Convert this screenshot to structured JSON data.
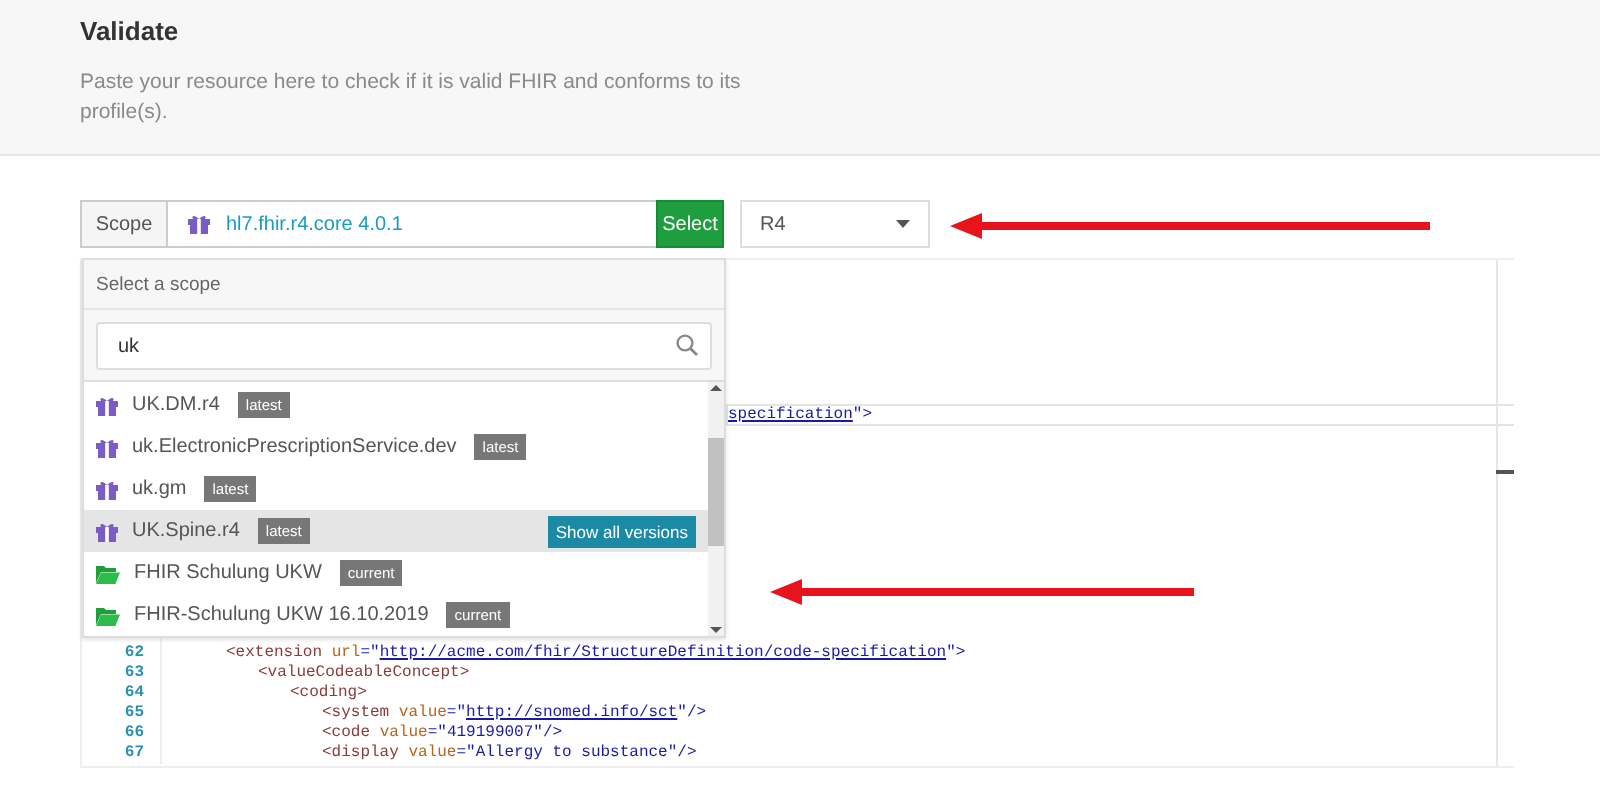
{
  "header": {
    "title": "Validate",
    "description": "Paste your resource here to check if it is valid FHIR and conforms to its profile(s)."
  },
  "toolbar": {
    "scope_label": "Scope",
    "scope_value": "hl7.fhir.r4.core 4.0.1",
    "select_button": "Select",
    "version": "R4"
  },
  "scope_dropdown": {
    "title": "Select a scope",
    "search": {
      "value": "uk"
    },
    "items": [
      {
        "kind": "package",
        "name": "UK.DM.r4",
        "badge": "latest",
        "selected": false
      },
      {
        "kind": "package",
        "name": "uk.ElectronicPrescriptionService.dev",
        "badge": "latest",
        "selected": false
      },
      {
        "kind": "package",
        "name": "uk.gm",
        "badge": "latest",
        "selected": false
      },
      {
        "kind": "package",
        "name": "UK.Spine.r4",
        "badge": "latest",
        "selected": true,
        "action": "Show all versions"
      },
      {
        "kind": "project",
        "name": "FHIR Schulung UKW",
        "badge": "current",
        "selected": false
      },
      {
        "kind": "project",
        "name": "FHIR-Schulung UKW 16.10.2019",
        "badge": "current",
        "selected": false
      }
    ]
  },
  "editor": {
    "fragment": [
      {
        "kind": "link",
        "text": "specification"
      },
      {
        "kind": "punct",
        "text": "\">"
      }
    ],
    "lines": [
      {
        "number": "62",
        "tokens": [
          {
            "kind": "tag",
            "text": "<extension"
          },
          {
            "kind": "attr",
            "text": " url"
          },
          {
            "kind": "punct",
            "text": "=\""
          },
          {
            "kind": "link",
            "text": "http://acme.com/fhir/StructureDefinition/code-specification"
          },
          {
            "kind": "punct",
            "text": "\">"
          }
        ],
        "children": [
          {
            "number": "63",
            "tokens": [
              {
                "kind": "tag",
                "text": "<valueCodeableConcept>"
              }
            ],
            "children": [
              {
                "number": "64",
                "tokens": [
                  {
                    "kind": "tag",
                    "text": "<coding>"
                  }
                ],
                "children": [
                  {
                    "number": "65",
                    "tokens": [
                      {
                        "kind": "tag",
                        "text": "<system"
                      },
                      {
                        "kind": "attr",
                        "text": " value"
                      },
                      {
                        "kind": "punct",
                        "text": "=\""
                      },
                      {
                        "kind": "link",
                        "text": "http://snomed.info/sct"
                      },
                      {
                        "kind": "punct",
                        "text": "\"/>"
                      }
                    ]
                  },
                  {
                    "number": "66",
                    "tokens": [
                      {
                        "kind": "tag",
                        "text": "<code"
                      },
                      {
                        "kind": "attr",
                        "text": " value"
                      },
                      {
                        "kind": "punct",
                        "text": "="
                      },
                      {
                        "kind": "string",
                        "text": "\"419199007\""
                      },
                      {
                        "kind": "punct",
                        "text": "/>"
                      }
                    ]
                  },
                  {
                    "number": "67",
                    "tokens": [
                      {
                        "kind": "tag",
                        "text": "<display"
                      },
                      {
                        "kind": "attr",
                        "text": " value"
                      },
                      {
                        "kind": "punct",
                        "text": "="
                      },
                      {
                        "kind": "string",
                        "text": "\"Allergy to substance\""
                      },
                      {
                        "kind": "punct",
                        "text": "/>"
                      }
                    ]
                  }
                ]
              }
            ]
          }
        ]
      }
    ]
  }
}
